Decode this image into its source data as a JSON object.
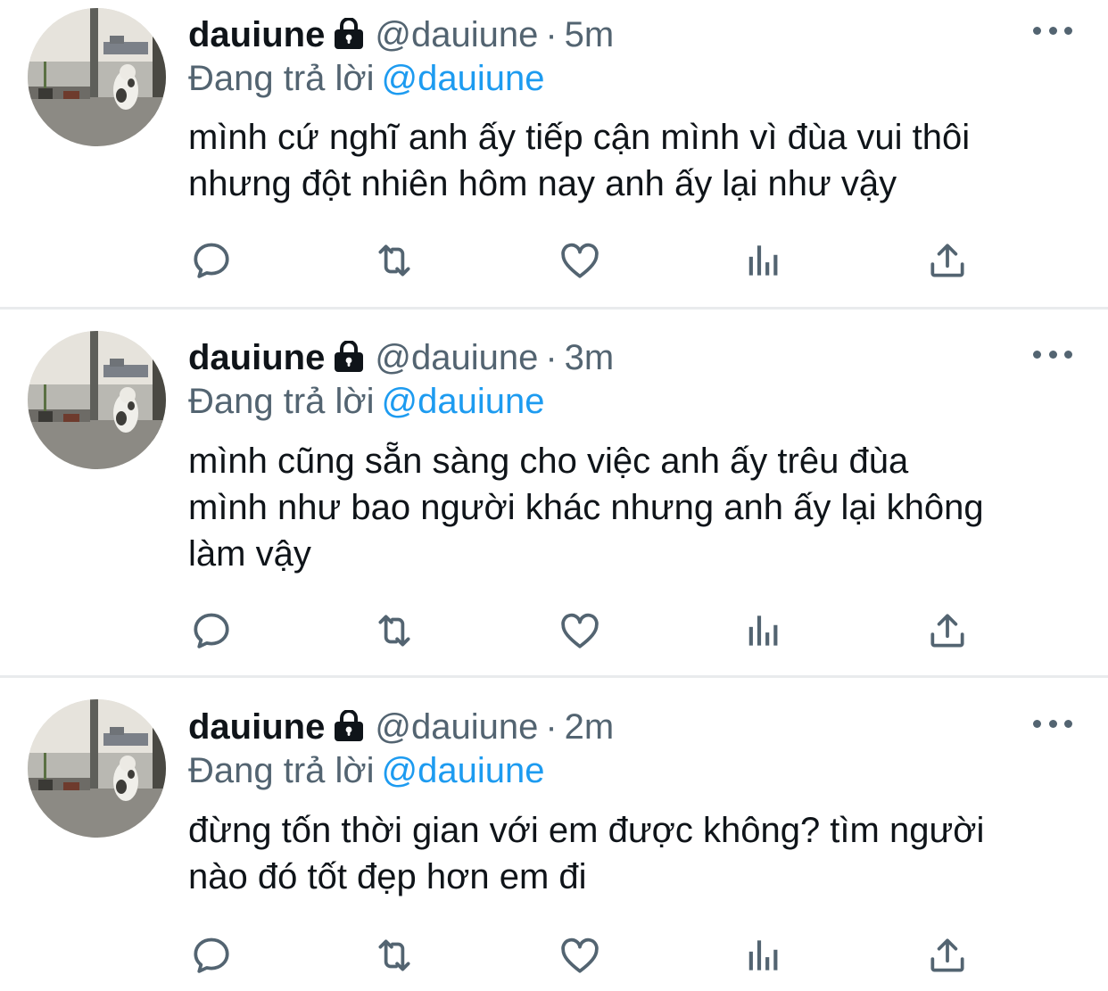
{
  "tweets": [
    {
      "name": "dauiune",
      "handle": "@dauiune",
      "separator": "·",
      "time": "5m",
      "reply_prefix": "Đang trả lời",
      "reply_to": "@dauiune",
      "text": "mình cứ nghĩ anh ấy tiếp cận mình vì đùa vui thôi\nnhưng đột nhiên hôm nay anh ấy lại như vậy"
    },
    {
      "name": "dauiune",
      "handle": "@dauiune",
      "separator": "·",
      "time": "3m",
      "reply_prefix": "Đang trả lời",
      "reply_to": "@dauiune",
      "text": "mình cũng sẵn sàng cho việc anh ấy trêu đùa\nmình như bao người khác nhưng anh ấy lại không\nlàm vậy"
    },
    {
      "name": "dauiune",
      "handle": "@dauiune",
      "separator": "·",
      "time": "2m",
      "reply_prefix": "Đang trả lời",
      "reply_to": "@dauiune",
      "text": "đừng tốn thời gian với em được không? tìm người\nnào đó tốt đẹp hơn em đi"
    }
  ],
  "icons": {
    "lock": "lock-icon",
    "more": "more-icon",
    "reply": "reply-icon",
    "retweet": "retweet-icon",
    "like": "heart-icon",
    "analytics": "analytics-icon",
    "share": "share-icon"
  },
  "colors": {
    "text": "#0f1419",
    "secondary": "#536471",
    "link": "#1d9bf0",
    "divider": "#e9ebed"
  }
}
